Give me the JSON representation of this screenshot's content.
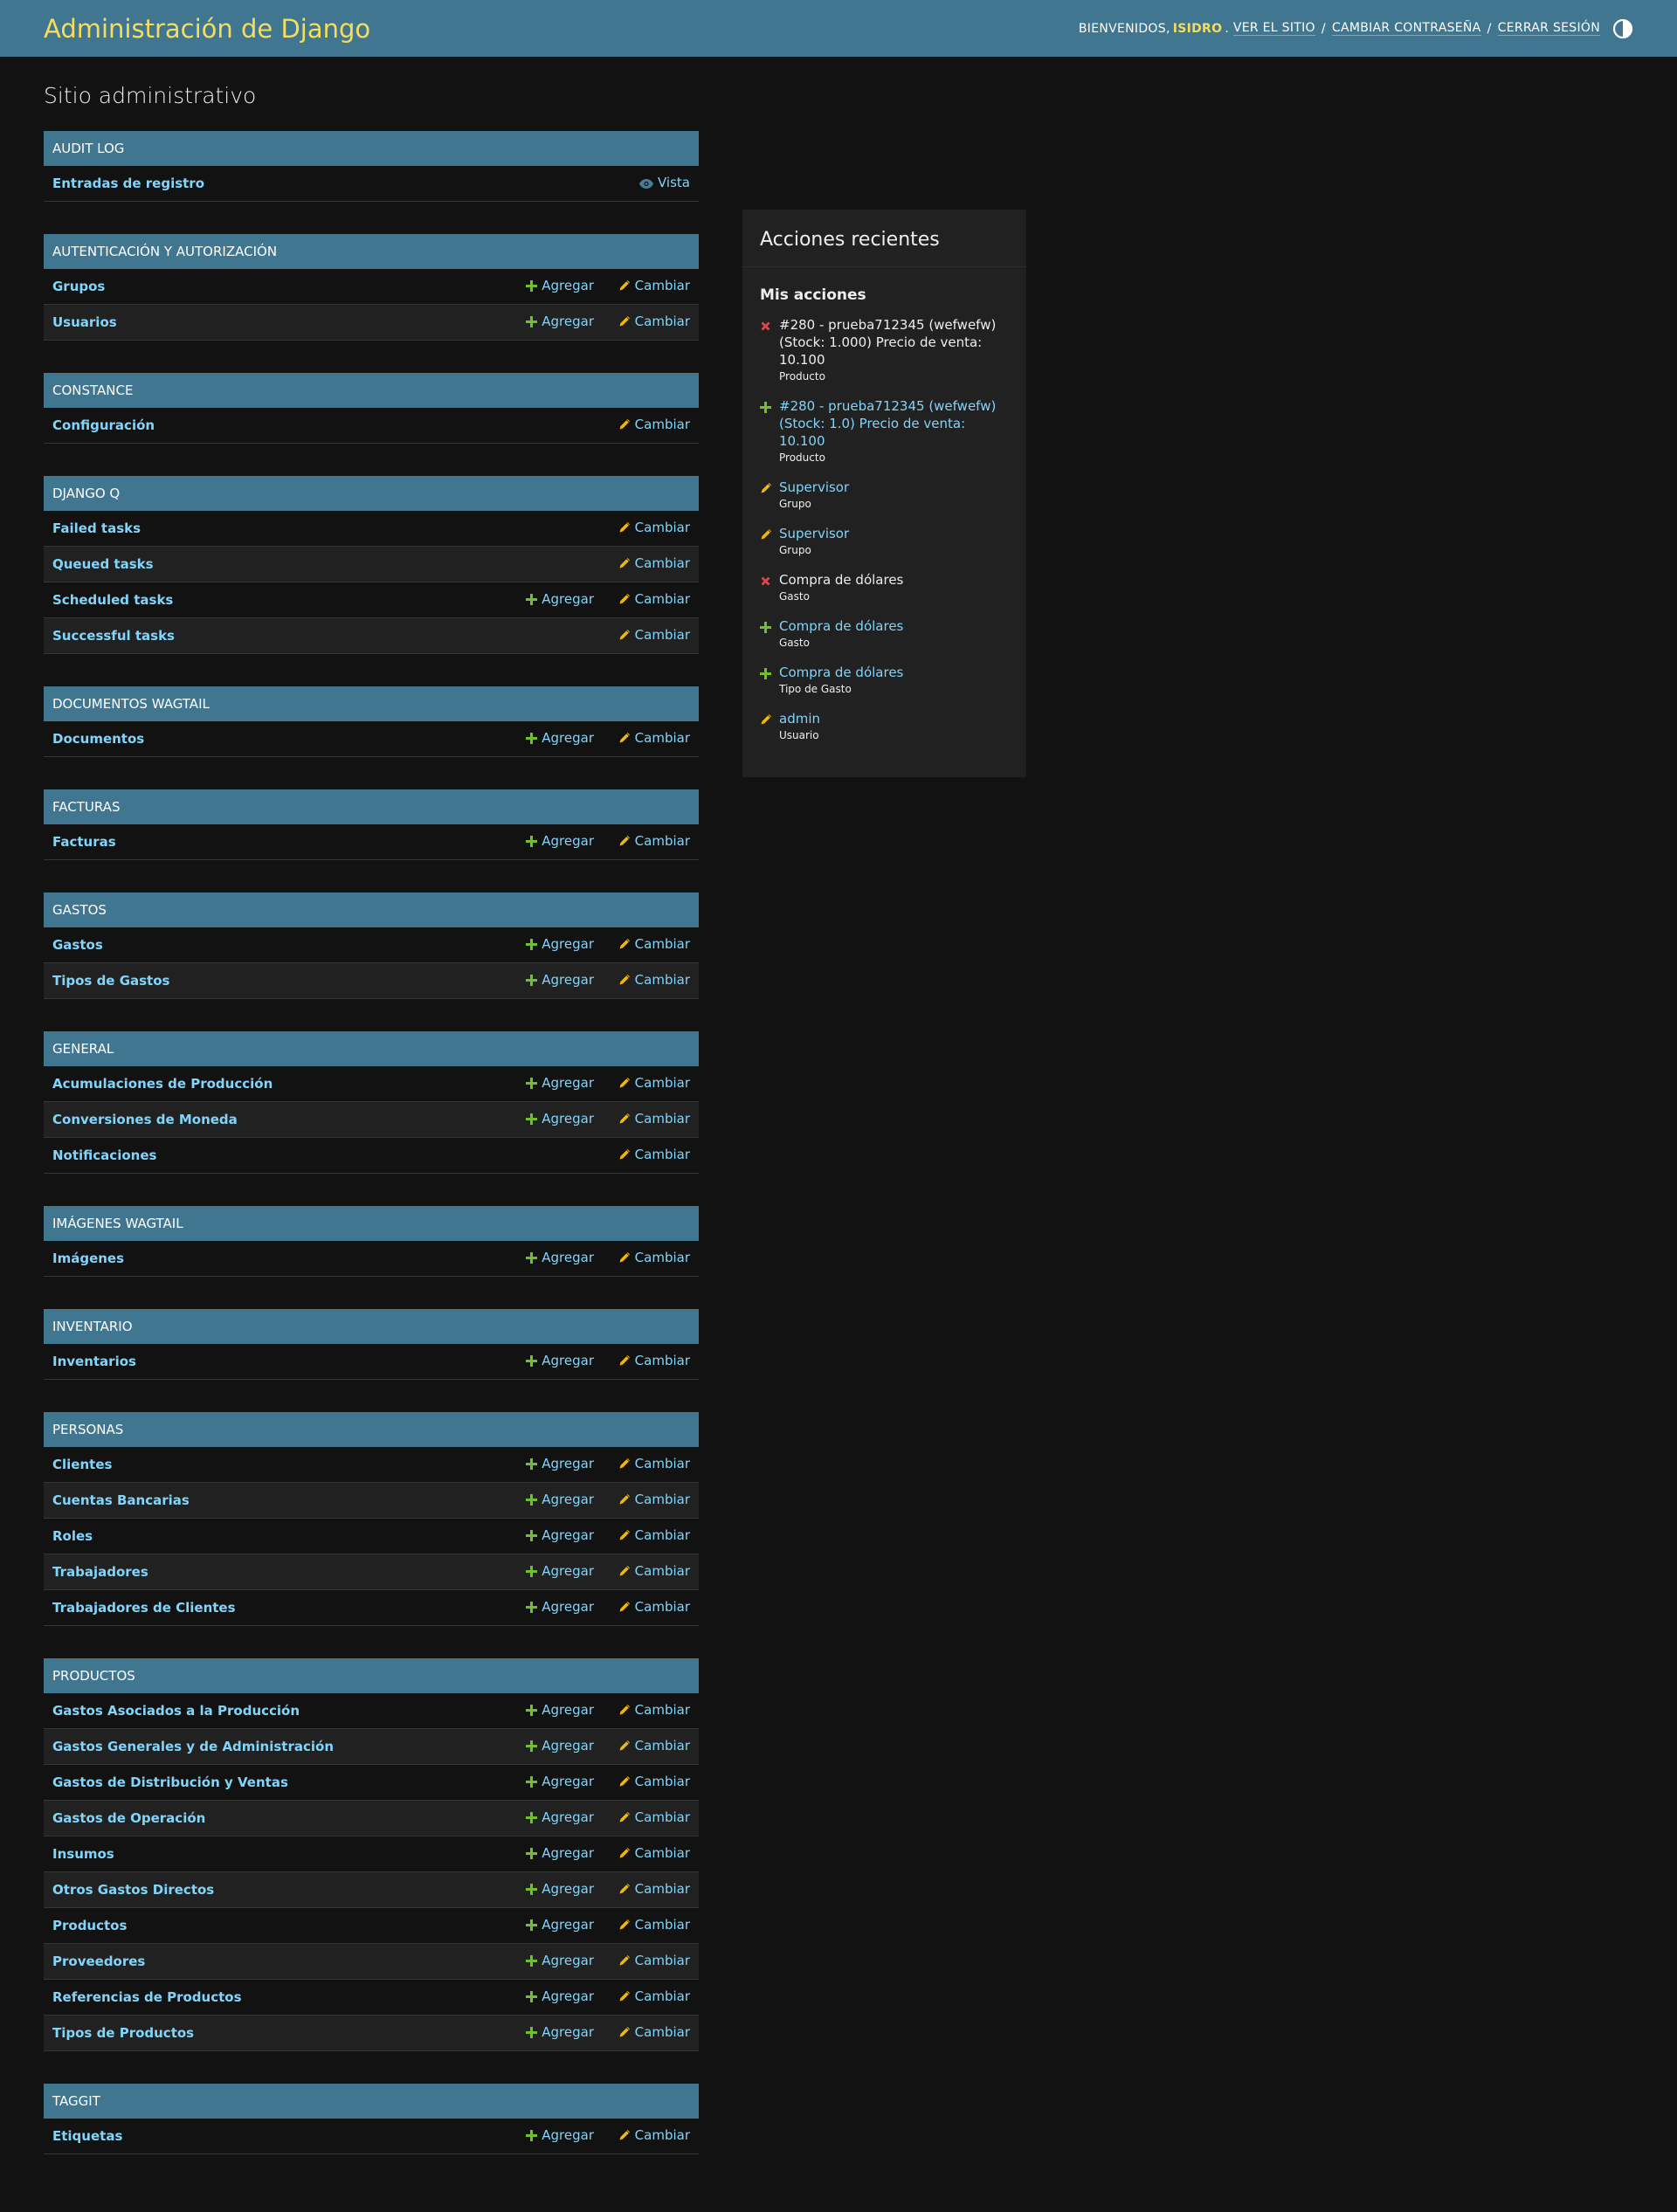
{
  "header": {
    "brand": "Administración de Django",
    "welcome": "Bienvenidos,",
    "username": "Isidro",
    "view_site": "Ver el sitio",
    "change_password": "Cambiar contraseña",
    "logout": "Cerrar sesión",
    "theme_icon": "contrast-icon"
  },
  "page_title": "Sitio administrativo",
  "labels": {
    "add": "Agregar",
    "change": "Cambiar",
    "view": "Vista"
  },
  "apps": [
    {
      "name": "Audit log",
      "models": [
        {
          "name": "Entradas de registro",
          "add": false,
          "change": false,
          "view": true
        }
      ]
    },
    {
      "name": "Autenticación y autorización",
      "models": [
        {
          "name": "Grupos",
          "add": true,
          "change": true
        },
        {
          "name": "Usuarios",
          "add": true,
          "change": true
        }
      ]
    },
    {
      "name": "Constance",
      "models": [
        {
          "name": "Configuración",
          "add": false,
          "change": true
        }
      ]
    },
    {
      "name": "Django Q",
      "models": [
        {
          "name": "Failed tasks",
          "add": false,
          "change": true
        },
        {
          "name": "Queued tasks",
          "add": false,
          "change": true
        },
        {
          "name": "Scheduled tasks",
          "add": true,
          "change": true
        },
        {
          "name": "Successful tasks",
          "add": false,
          "change": true
        }
      ]
    },
    {
      "name": "Documentos Wagtail",
      "models": [
        {
          "name": "Documentos",
          "add": true,
          "change": true
        }
      ]
    },
    {
      "name": "Facturas",
      "models": [
        {
          "name": "Facturas",
          "add": true,
          "change": true
        }
      ]
    },
    {
      "name": "Gastos",
      "models": [
        {
          "name": "Gastos",
          "add": true,
          "change": true
        },
        {
          "name": "Tipos de Gastos",
          "add": true,
          "change": true
        }
      ]
    },
    {
      "name": "General",
      "models": [
        {
          "name": "Acumulaciones de Producción",
          "add": true,
          "change": true
        },
        {
          "name": "Conversiones de Moneda",
          "add": true,
          "change": true
        },
        {
          "name": "Notificaciones",
          "add": false,
          "change": true
        }
      ]
    },
    {
      "name": "Imágenes Wagtail",
      "models": [
        {
          "name": "Imágenes",
          "add": true,
          "change": true
        }
      ]
    },
    {
      "name": "Inventario",
      "models": [
        {
          "name": "Inventarios",
          "add": true,
          "change": true
        }
      ]
    },
    {
      "name": "Personas",
      "models": [
        {
          "name": "Clientes",
          "add": true,
          "change": true
        },
        {
          "name": "Cuentas Bancarias",
          "add": true,
          "change": true
        },
        {
          "name": "Roles",
          "add": true,
          "change": true
        },
        {
          "name": "Trabajadores",
          "add": true,
          "change": true
        },
        {
          "name": "Trabajadores de Clientes",
          "add": true,
          "change": true
        }
      ]
    },
    {
      "name": "Productos",
      "models": [
        {
          "name": "Gastos Asociados a la Producción",
          "add": true,
          "change": true
        },
        {
          "name": "Gastos Generales y de Administración",
          "add": true,
          "change": true
        },
        {
          "name": "Gastos de Distribución y Ventas",
          "add": true,
          "change": true
        },
        {
          "name": "Gastos de Operación",
          "add": true,
          "change": true
        },
        {
          "name": "Insumos",
          "add": true,
          "change": true
        },
        {
          "name": "Otros Gastos Directos",
          "add": true,
          "change": true
        },
        {
          "name": "Productos",
          "add": true,
          "change": true
        },
        {
          "name": "Proveedores",
          "add": true,
          "change": true
        },
        {
          "name": "Referencias de Productos",
          "add": true,
          "change": true
        },
        {
          "name": "Tipos de Productos",
          "add": true,
          "change": true
        }
      ]
    },
    {
      "name": "Taggit",
      "models": [
        {
          "name": "Etiquetas",
          "add": true,
          "change": true
        }
      ]
    }
  ],
  "recent": {
    "title": "Acciones recientes",
    "subtitle": "Mis acciones",
    "items": [
      {
        "kind": "delete",
        "title": "#280 - prueba712345 (wefwefw) (Stock: 1.000) Precio de venta: 10.100",
        "type": "Producto",
        "link": false
      },
      {
        "kind": "add",
        "title": "#280 - prueba712345 (wefwefw) (Stock: 1.0) Precio de venta: 10.100",
        "type": "Producto",
        "link": true
      },
      {
        "kind": "change",
        "title": "Supervisor",
        "type": "Grupo",
        "link": true
      },
      {
        "kind": "change",
        "title": "Supervisor",
        "type": "Grupo",
        "link": true
      },
      {
        "kind": "delete",
        "title": "Compra de dólares",
        "type": "Gasto",
        "link": false
      },
      {
        "kind": "add",
        "title": "Compra de dólares",
        "type": "Gasto",
        "link": true
      },
      {
        "kind": "add",
        "title": "Compra de dólares",
        "type": "Tipo de Gasto",
        "link": true
      },
      {
        "kind": "change",
        "title": "admin",
        "type": "Usuario",
        "link": true
      }
    ]
  },
  "colors": {
    "header_bg": "#417690",
    "brand": "#f5dd5d",
    "link": "#81d4fa",
    "add_icon": "#70bf2b",
    "change_icon": "#efb80b",
    "delete_icon": "#dd4646",
    "view_icon": "#447e9b",
    "body_bg": "#121212"
  }
}
